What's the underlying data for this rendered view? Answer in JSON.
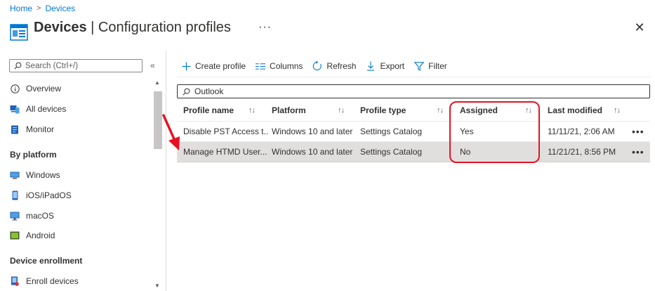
{
  "breadcrumb": {
    "home": "Home",
    "current": "Devices"
  },
  "header": {
    "title_bold": "Devices",
    "title_rest": " | Configuration profiles",
    "more": "···",
    "close": "✕"
  },
  "sidebar": {
    "search_placeholder": "Search (Ctrl+/)",
    "collapse": "«",
    "items": [
      {
        "label": "Overview",
        "icon": "info-icon"
      },
      {
        "label": "All devices",
        "icon": "devices-icon"
      },
      {
        "label": "Monitor",
        "icon": "monitor-icon"
      }
    ],
    "section_platform": "By platform",
    "platform_items": [
      {
        "label": "Windows",
        "icon": "windows-icon"
      },
      {
        "label": "iOS/iPadOS",
        "icon": "ios-icon"
      },
      {
        "label": "macOS",
        "icon": "macos-icon"
      },
      {
        "label": "Android",
        "icon": "android-icon"
      }
    ],
    "section_enrollment": "Device enrollment",
    "enrollment_items": [
      {
        "label": "Enroll devices",
        "icon": "enroll-icon"
      }
    ]
  },
  "toolbar": {
    "create": "Create profile",
    "columns": "Columns",
    "refresh": "Refresh",
    "export": "Export",
    "filter": "Filter"
  },
  "filter_input": {
    "value": "Outlook"
  },
  "table": {
    "columns": [
      "Profile name",
      "Platform",
      "Profile type",
      "Assigned",
      "Last modified"
    ],
    "sort_glyph": "↑↓",
    "rows": [
      {
        "name": "Disable PST Access t...",
        "platform": "Windows 10 and later",
        "type": "Settings Catalog",
        "assigned": "Yes",
        "modified": "11/11/21, 2:06 AM",
        "more": "•••"
      },
      {
        "name": "Manage HTMD User...",
        "platform": "Windows 10 and later",
        "type": "Settings Catalog",
        "assigned": "No",
        "modified": "11/21/21, 8:56 PM",
        "more": "•••"
      }
    ]
  },
  "colors": {
    "accent": "#0078d4",
    "highlight": "#e81123",
    "selected_row": "#e1dfdd"
  }
}
